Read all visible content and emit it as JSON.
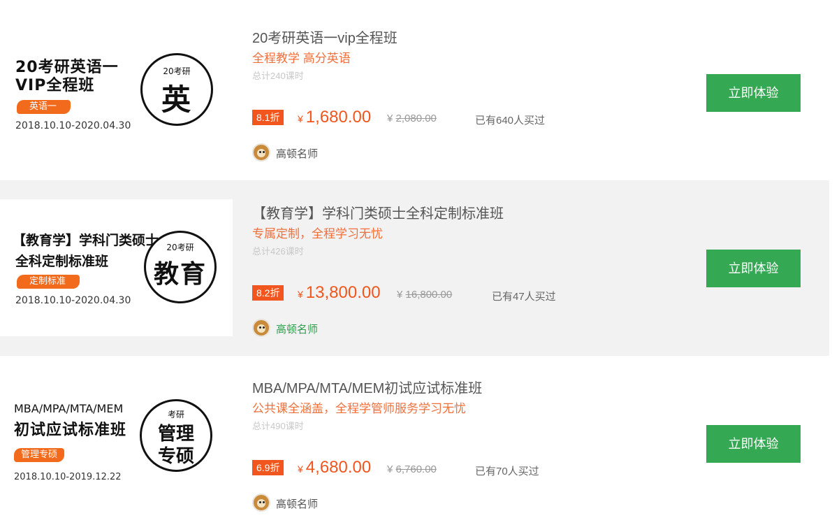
{
  "courses": [
    {
      "thumb": {
        "pre": "",
        "title_line1": "20考研英语一",
        "title_line2": "VIP全程班",
        "tag": "英语一",
        "date": "2018.10.10-2020.04.30",
        "circle_small": "20考研",
        "circle_big": "英",
        "circle_big2": ""
      },
      "name": "20考研英语一vip全程班",
      "slogan": "全程教学 高分英语",
      "hours": "总计240课时",
      "discount": "8.1折",
      "price_symbol": "¥",
      "price": "1,680.00",
      "orig_symbol": "¥",
      "orig_price": "2,080.00",
      "sold": "已有640人买过",
      "teacher": "高顿名师",
      "button": "立即体验"
    },
    {
      "thumb": {
        "pre": "",
        "title_line1": "【教育学】学科门类硕士",
        "title_line2": "全科定制标准班",
        "tag": "定制标准",
        "date": "2018.10.10-2020.04.30",
        "circle_small": "20考研",
        "circle_big": "教育",
        "circle_big2": ""
      },
      "name": "【教育学】学科门类硕士全科定制标准班",
      "slogan": "专属定制，全程学习无忧",
      "hours": "总计426课时",
      "discount": "8.2折",
      "price_symbol": "¥",
      "price": "13,800.00",
      "orig_symbol": "¥",
      "orig_price": "16,800.00",
      "sold": "已有47人买过",
      "teacher": "高顿名师",
      "button": "立即体验"
    },
    {
      "thumb": {
        "pre": "MBA/MPA/MTA/MEM",
        "title_line1": "初试应试标准班",
        "title_line2": "",
        "tag": "管理专硕",
        "date": "2018.10.10-2019.12.22",
        "circle_small": "考研",
        "circle_big": "管理",
        "circle_big2": "专硕"
      },
      "name": "MBA/MPA/MTA/MEM初试应试标准班",
      "slogan": "公共课全涵盖，全程学管师服务学习无忧",
      "hours": "总计490课时",
      "discount": "6.9折",
      "price_symbol": "¥",
      "price": "4,680.00",
      "orig_symbol": "¥",
      "orig_price": "6,760.00",
      "sold": "已有70人买过",
      "teacher": "高顿名师",
      "button": "立即体验"
    }
  ],
  "colors": {
    "accent_orange": "#f0561d",
    "slogan_orange": "#f0703c",
    "button_green": "#35a853",
    "alt_row_bg": "#f2f2f2"
  },
  "icons": {
    "teacher_avatar": "teacher-avatar-icon"
  }
}
